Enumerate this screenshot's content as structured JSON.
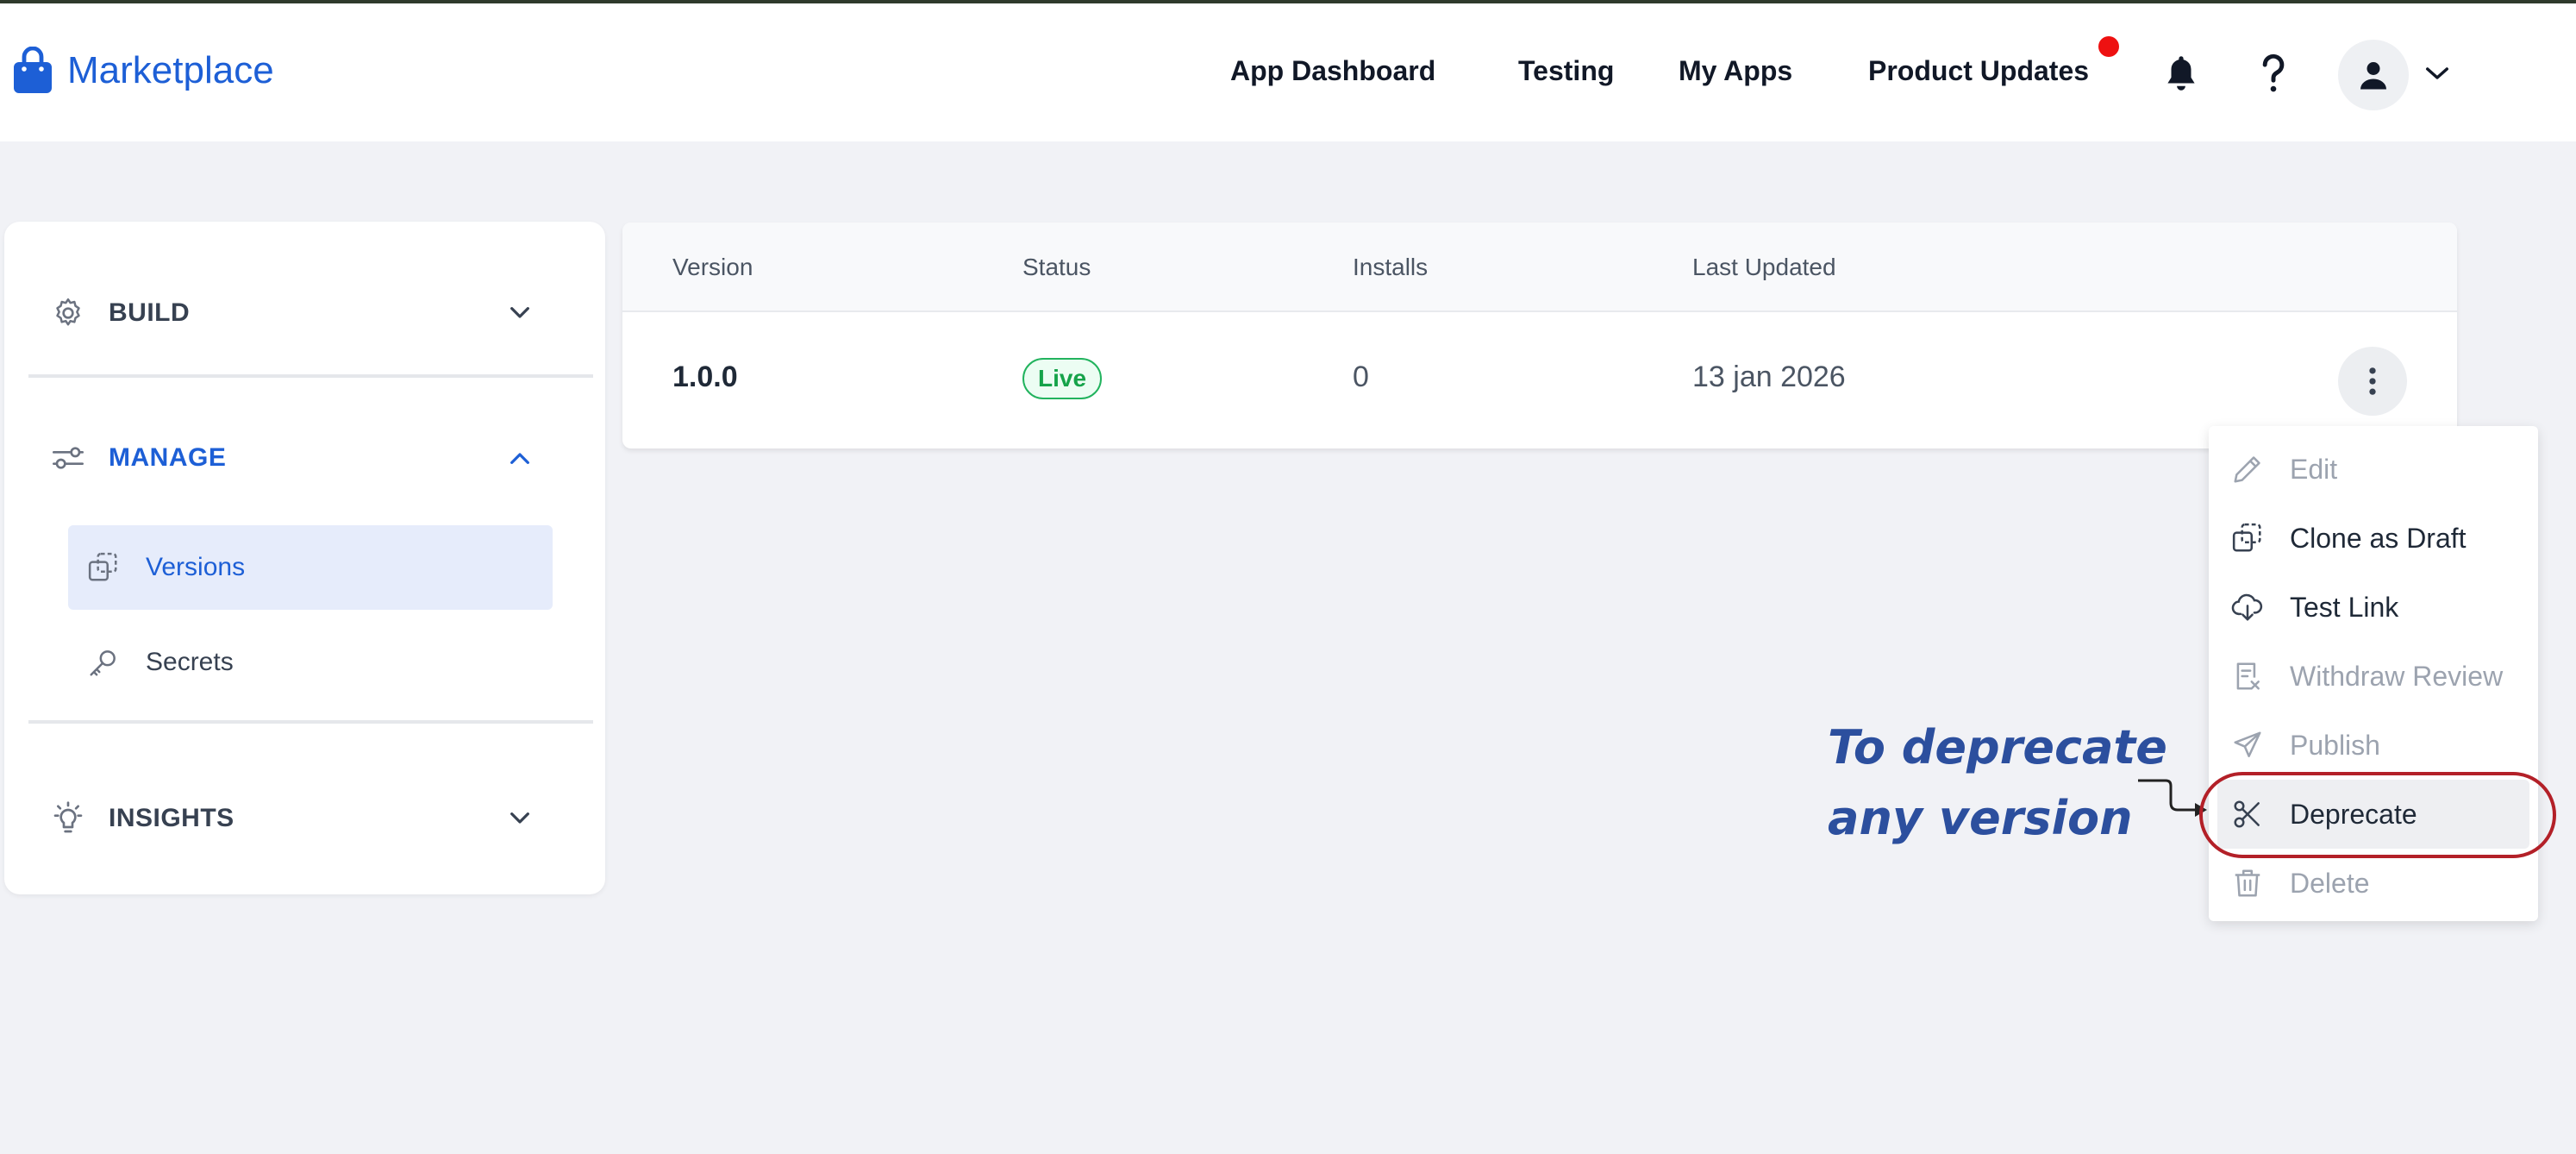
{
  "header": {
    "brand": "Marketplace",
    "nav": [
      "App Dashboard",
      "Testing",
      "My Apps",
      "Product Updates"
    ],
    "notification_dot_color": "#ee1111"
  },
  "sidebar": {
    "sections": [
      {
        "title": "BUILD",
        "icon": "gear-icon",
        "expanded": false
      },
      {
        "title": "MANAGE",
        "icon": "sliders-icon",
        "expanded": true
      },
      {
        "title": "INSIGHTS",
        "icon": "lightbulb-icon",
        "expanded": false
      }
    ],
    "manage_items": [
      {
        "label": "Versions",
        "icon": "copy-icon",
        "active": true
      },
      {
        "label": "Secrets",
        "icon": "key-icon",
        "active": false
      }
    ]
  },
  "table": {
    "columns": [
      "Version",
      "Status",
      "Installs",
      "Last Updated"
    ],
    "rows": [
      {
        "version": "1.0.0",
        "status": "Live",
        "installs": "0",
        "last_updated": "13 jan 2026"
      }
    ]
  },
  "menu": {
    "items": [
      {
        "label": "Edit",
        "icon": "pencil-icon",
        "disabled": true
      },
      {
        "label": "Clone as Draft",
        "icon": "clone-icon",
        "disabled": false
      },
      {
        "label": "Test Link",
        "icon": "download-cloud-icon",
        "disabled": false
      },
      {
        "label": "Withdraw Review",
        "icon": "withdraw-document-icon",
        "disabled": true
      },
      {
        "label": "Publish",
        "icon": "send-icon",
        "disabled": true
      },
      {
        "label": "Deprecate",
        "icon": "scissors-icon",
        "disabled": false,
        "hovered": true
      },
      {
        "label": "Delete",
        "icon": "trash-icon",
        "disabled": true
      }
    ]
  },
  "annotation": {
    "line1": "To deprecate",
    "line2": "any version"
  },
  "colors": {
    "accent": "#1d5fd6",
    "live_badge": "#16a34a",
    "annotation": "#2c4f9e",
    "highlight": "#b32028"
  }
}
